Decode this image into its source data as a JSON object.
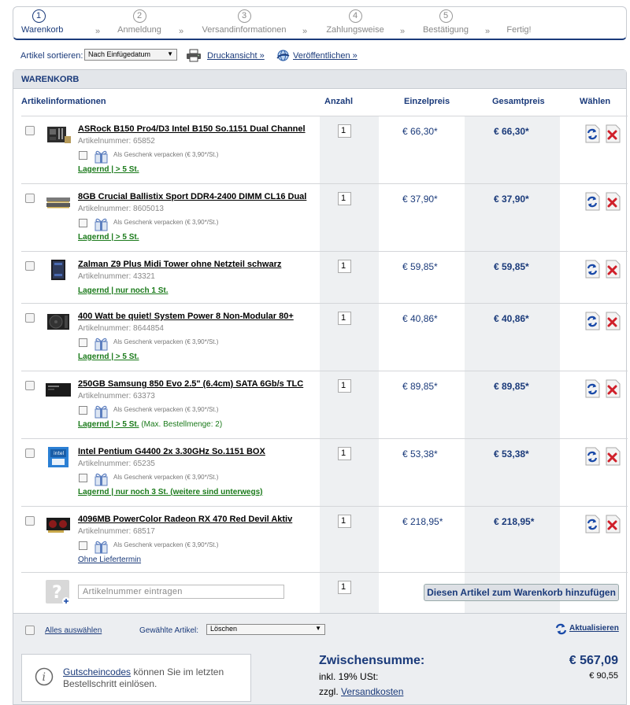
{
  "steps": [
    {
      "num": "1",
      "label": "Warenkorb",
      "active": true
    },
    {
      "num": "2",
      "label": "Anmeldung"
    },
    {
      "num": "3",
      "label": "Versandinformationen"
    },
    {
      "num": "4",
      "label": "Zahlungsweise"
    },
    {
      "num": "5",
      "label": "Bestätigung"
    },
    {
      "num": "",
      "label": "Fertig!"
    }
  ],
  "step_separator": "»",
  "toolbar": {
    "sort_label": "Artikel sortieren:",
    "sort_value": "Nach Einfügedatum",
    "print_link": "Druckansicht »",
    "publish_link": "Veröffentlichen »"
  },
  "cart": {
    "title": "WARENKORB",
    "columns": {
      "info": "Artikelinformationen",
      "qty": "Anzahl",
      "unit_price": "Einzelpreis",
      "total": "Gesamtpreis",
      "select": "Wählen"
    },
    "gift_text": "Als Geschenk verpacken (€ 3,90*/St.)",
    "items": [
      {
        "title": "ASRock B150 Pro4/D3 Intel B150 So.1151 Dual Channel",
        "artnr": "Artikelnummer: 65852",
        "stock": "Lagernd | > 5 St.",
        "stock_extra": "",
        "qty": "1",
        "price": "€ 66,30*",
        "total": "€ 66,30*",
        "thumb": "mainboard-icon"
      },
      {
        "title": "8GB Crucial Ballistix Sport DDR4-2400 DIMM CL16 Dual",
        "artnr": "Artikelnummer: 8605013",
        "stock": "Lagernd | > 5 St.",
        "stock_extra": "",
        "qty": "1",
        "price": "€ 37,90*",
        "total": "€ 37,90*",
        "thumb": "ram-icon"
      },
      {
        "title": "Zalman Z9 Plus Midi Tower ohne Netzteil schwarz",
        "artnr": "Artikelnummer: 43321",
        "stock": "Lagernd | nur noch 1 St.",
        "stock_extra": "",
        "qty": "1",
        "price": "€ 59,85*",
        "total": "€ 59,85*",
        "thumb": "case-icon"
      },
      {
        "title": "400 Watt be quiet! System Power 8 Non-Modular 80+",
        "artnr": "Artikelnummer: 8644854",
        "stock": "Lagernd | > 5 St.",
        "stock_extra": "",
        "qty": "1",
        "price": "€ 40,86*",
        "total": "€ 40,86*",
        "thumb": "psu-icon"
      },
      {
        "title": "250GB Samsung 850 Evo 2.5\" (6.4cm) SATA 6Gb/s TLC",
        "artnr": "Artikelnummer: 63373",
        "stock": "Lagernd | > 5 St.",
        "stock_extra": "(Max. Bestellmenge: 2)",
        "qty": "1",
        "price": "€ 89,85*",
        "total": "€ 89,85*",
        "thumb": "ssd-icon"
      },
      {
        "title": "Intel Pentium G4400 2x 3.30GHz So.1151 BOX",
        "artnr": "Artikelnummer: 65235",
        "stock": "Lagernd | nur noch 3 St. (weitere sind unterwegs)",
        "stock_extra": "",
        "qty": "1",
        "price": "€ 53,38*",
        "total": "€ 53,38*",
        "thumb": "cpu-icon"
      },
      {
        "title": "4096MB PowerColor Radeon RX 470 Red Devil Aktiv",
        "artnr": "Artikelnummer: 68517",
        "stock": "Ohne Liefertermin",
        "stock_extra": "",
        "qty": "1",
        "price": "€ 218,95*",
        "total": "€ 218,95*",
        "thumb": "gpu-icon"
      }
    ],
    "add": {
      "placeholder": "Artikelnummer eintragen",
      "qty": "1",
      "button": "Diesen Artikel zum Warenkorb hinzufügen"
    },
    "footer": {
      "select_all": "Alles auswählen",
      "selected_label": "Gewählte Artikel:",
      "action": "Löschen",
      "update": "Aktualisieren"
    }
  },
  "summary": {
    "coupon_link": "Gutscheincodes",
    "coupon_text": " können Sie im letzten Bestellschritt einlösen.",
    "subtotal_label": "Zwischensumme:",
    "subtotal_value": "€ 567,09",
    "tax_label": "inkl. 19% USt:",
    "tax_value": "€ 90,55",
    "shipping_prefix": "zzgl. ",
    "shipping_link": "Versandkosten"
  },
  "colors": {
    "accent": "#1a3a7a",
    "stock_green": "#1a7a1a",
    "delete_red": "#d0202a"
  }
}
